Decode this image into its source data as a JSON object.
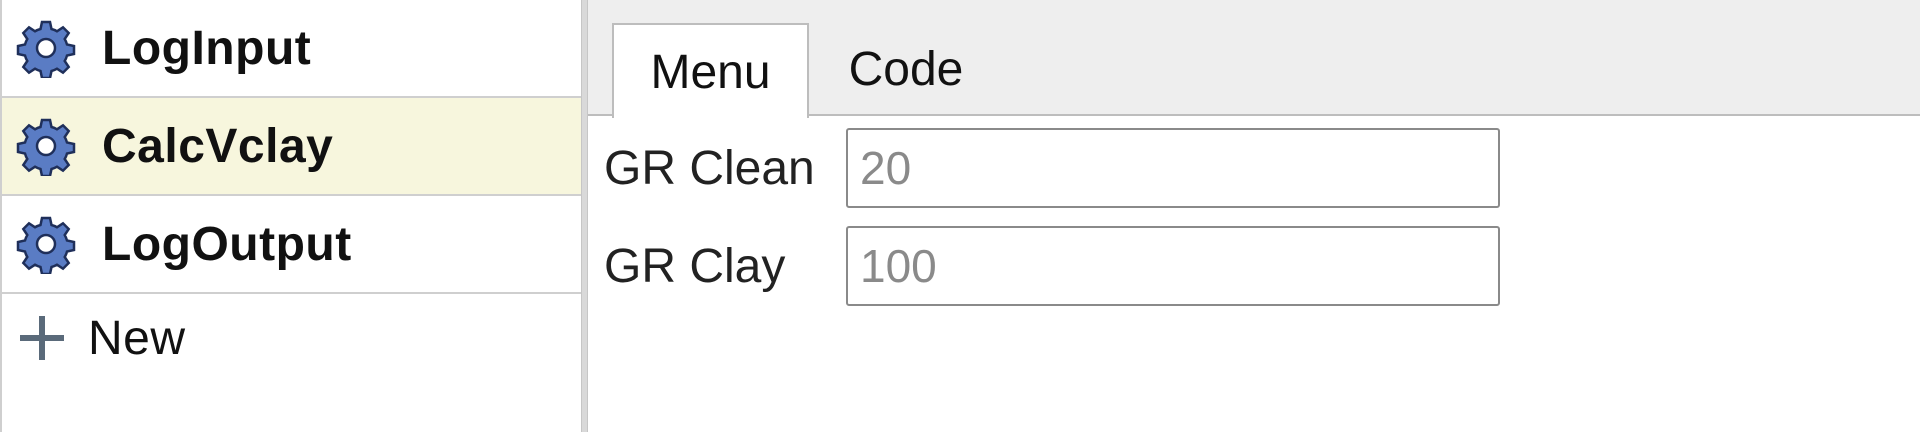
{
  "sidebar": {
    "items": [
      {
        "label": "LogInput",
        "icon": "gear-icon",
        "selected": false
      },
      {
        "label": "CalcVclay",
        "icon": "gear-icon",
        "selected": true
      },
      {
        "label": "LogOutput",
        "icon": "gear-icon",
        "selected": false
      }
    ],
    "new_item": {
      "label": "New",
      "icon": "plus-icon"
    }
  },
  "tabs": [
    {
      "label": "Menu",
      "active": true
    },
    {
      "label": "Code",
      "active": false
    }
  ],
  "form": {
    "fields": [
      {
        "label": "GR Clean",
        "placeholder": "20",
        "value": ""
      },
      {
        "label": "GR Clay",
        "placeholder": "100",
        "value": ""
      }
    ]
  },
  "colors": {
    "selected_row": "#f7f6dd",
    "gear_fill": "#5a7cc4",
    "tabbar_bg": "#eeeeee"
  }
}
